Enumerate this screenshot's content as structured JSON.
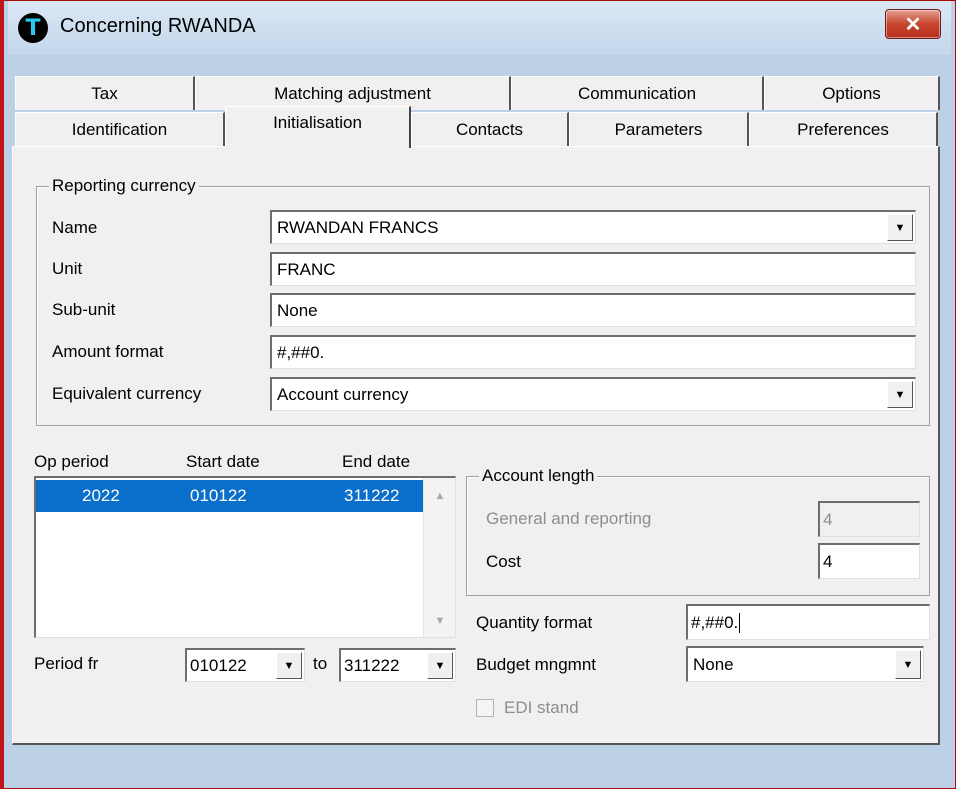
{
  "window": {
    "title": "Concerning RWANDA",
    "icon_glyph": "T",
    "close_glyph": "✕"
  },
  "tabs": {
    "row1": [
      "Tax",
      "Matching adjustment",
      "Communication",
      "Options"
    ],
    "row2": [
      "Identification",
      "Initialisation",
      "Contacts",
      "Parameters",
      "Preferences"
    ],
    "selected": "Initialisation"
  },
  "reporting_currency": {
    "group_title": "Reporting currency",
    "name_label": "Name",
    "name_value": "RWANDAN FRANCS",
    "unit_label": "Unit",
    "unit_value": "FRANC",
    "subunit_label": "Sub-unit",
    "subunit_value": "None",
    "amount_format_label": "Amount format",
    "amount_format_value": "#,##0.",
    "equivalent_label": "Equivalent currency",
    "equivalent_value": "Account currency"
  },
  "periods": {
    "col_op_period": "Op period",
    "col_start_date": "Start date",
    "col_end_date": "End date",
    "rows": [
      {
        "op_period": "2022",
        "start_date": "010122",
        "end_date": "311222"
      }
    ],
    "period_from_label": "Period fr",
    "period_from_value": "010122",
    "to_label": "to",
    "period_to_value": "311222"
  },
  "account_length": {
    "group_title": "Account length",
    "general_label": "General and reporting",
    "general_value": "4",
    "cost_label": "Cost",
    "cost_value": "4"
  },
  "misc": {
    "quantity_format_label": "Quantity format",
    "quantity_format_value": "#,##0.",
    "budget_label": "Budget mngmnt",
    "budget_value": "None",
    "edi_label": "EDI stand"
  },
  "icons": {
    "dropdown": "▼",
    "scroll_up": "▲",
    "scroll_down": "▼"
  },
  "colors": {
    "selection": "#0a6ecb",
    "title_bar": "#c4d7ec",
    "close_button": "#c9452f"
  }
}
